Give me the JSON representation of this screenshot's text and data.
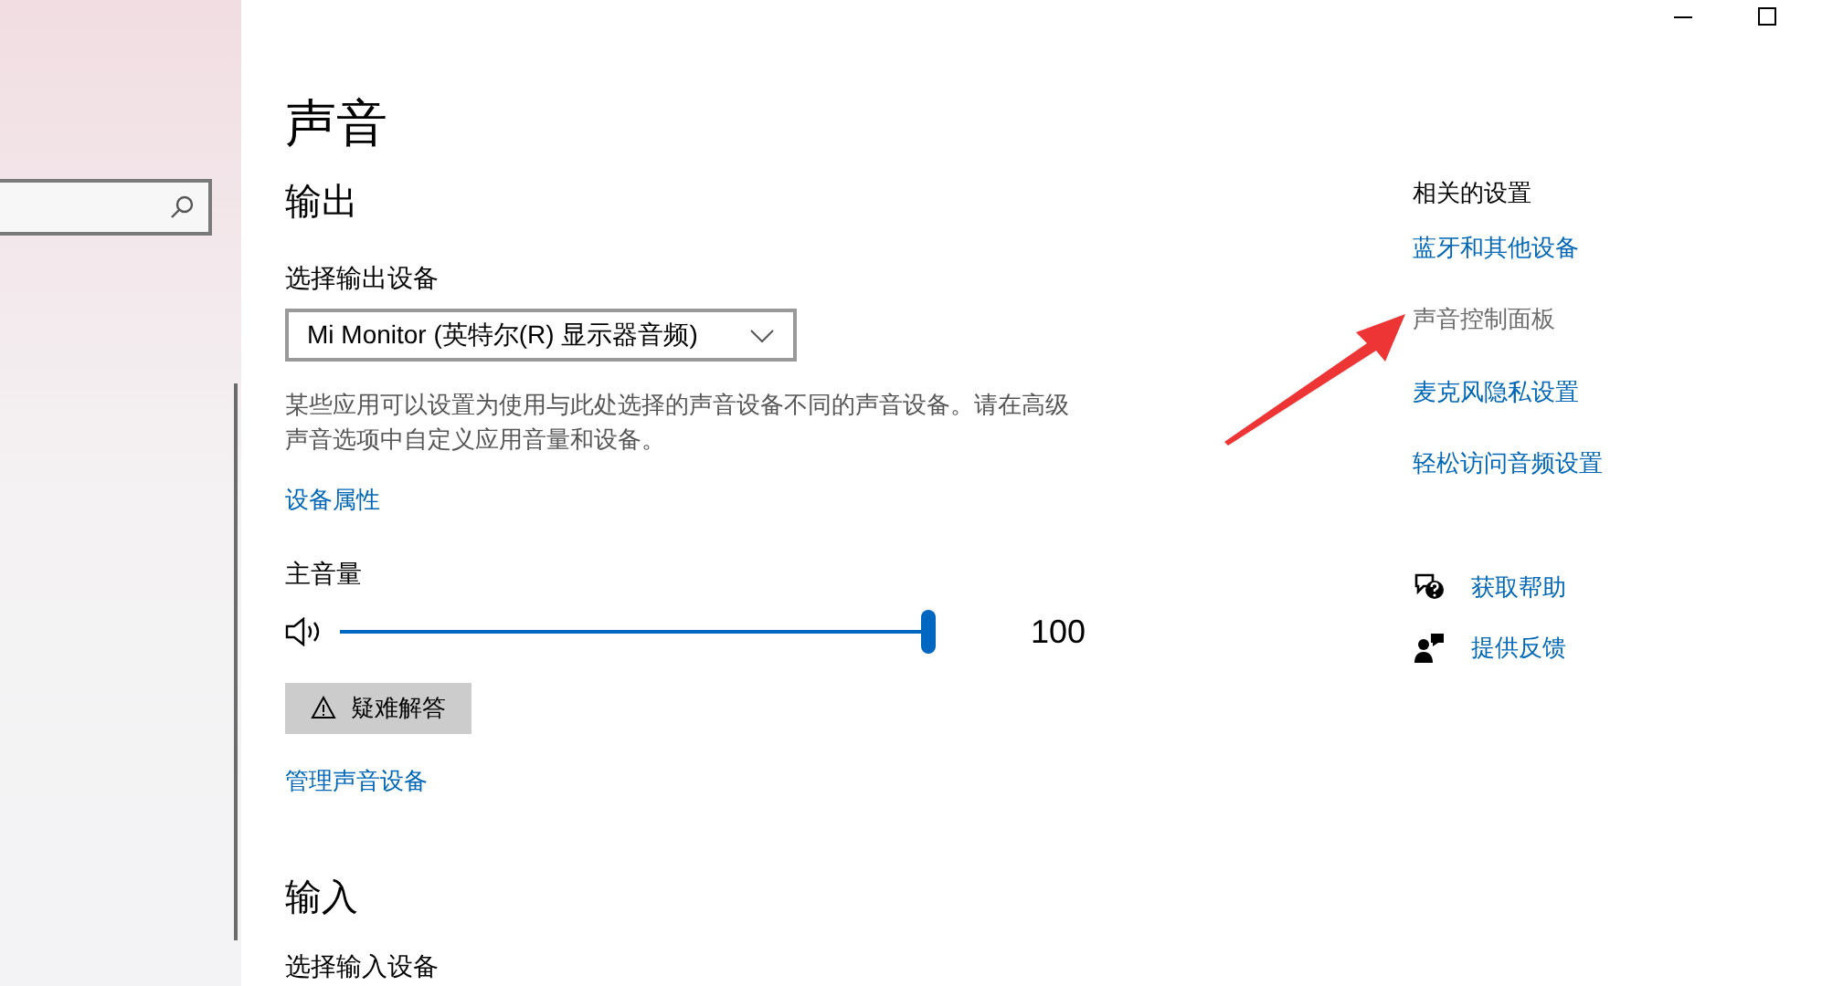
{
  "page_title": "声音",
  "output": {
    "heading": "输出",
    "device_label": "选择输出设备",
    "device_value": "Mi Monitor (英特尔(R) 显示器音频)",
    "description": "某些应用可以设置为使用与此处选择的声音设备不同的声音设备。请在高级声音选项中自定义应用音量和设备。",
    "properties_link": "设备属性",
    "volume_label": "主音量",
    "volume": {
      "level": 1.0,
      "reading": "100"
    },
    "troubleshoot_button": "疑难解答",
    "manage_link": "管理声音设备"
  },
  "input": {
    "heading": "输入",
    "device_label": "选择输入设备"
  },
  "related": {
    "heading": "相关的设置",
    "links": [
      {
        "label": "蓝牙和其他设备",
        "hovered": false
      },
      {
        "label": "声音控制面板",
        "hovered": true
      },
      {
        "label": "麦克风隐私设置",
        "hovered": false
      },
      {
        "label": "轻松访问音频设置",
        "hovered": false
      }
    ]
  },
  "help": [
    {
      "kind": "help",
      "label": "获取帮助"
    },
    {
      "kind": "feedback",
      "label": "提供反馈"
    }
  ]
}
